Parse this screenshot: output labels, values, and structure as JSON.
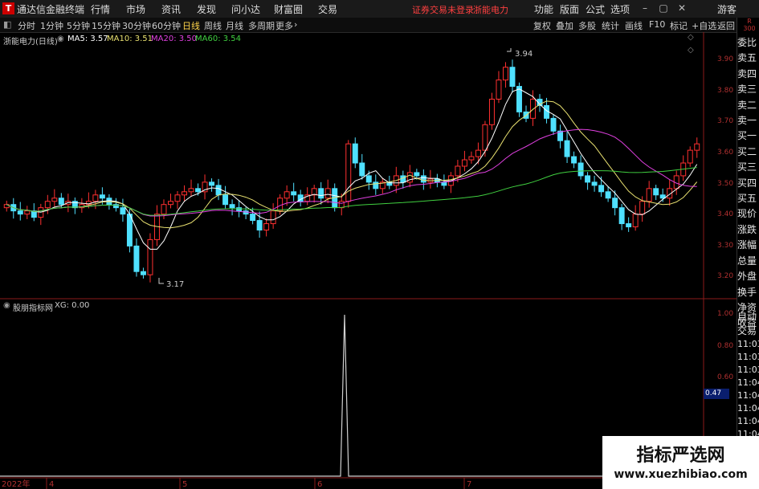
{
  "app": {
    "title": "通达信金融终端",
    "logo": "T"
  },
  "menu": [
    "行情",
    "市场",
    "资讯",
    "发现",
    "问小达",
    "财富圈",
    "交易"
  ],
  "notice": "证券交易未登录",
  "stock_name_top": "浙能电力",
  "top_right": [
    "功能",
    "版面",
    "公式",
    "选项"
  ],
  "guest": "游客",
  "periods": [
    "分时",
    "1分钟",
    "5分钟",
    "15分钟",
    "30分钟",
    "60分钟",
    "日线",
    "周线",
    "月线",
    "多周期",
    "更多"
  ],
  "active_period": "日线",
  "tools": [
    "复权",
    "叠加",
    "多股",
    "统计",
    "画线",
    "F10",
    "标记",
    "+自选",
    "返回"
  ],
  "main_legend": {
    "name": "浙能电力(日线)",
    "ma5": "MA5: 3.57",
    "ma10": "MA10: 3.51",
    "ma20": "MA20: 3.50",
    "ma60": "MA60: 3.54"
  },
  "sub_legend": {
    "name": "股朋指标网",
    "xg": "XG: 0.00"
  },
  "price_axis": [
    "3.90",
    "3.80",
    "3.70",
    "3.60",
    "3.50",
    "3.40",
    "3.30",
    "3.20"
  ],
  "sub_axis": [
    "1.00",
    "0.80",
    "0.60",
    "0.47"
  ],
  "annotations": {
    "high": "3.94",
    "low": "3.17"
  },
  "x_axis": [
    "2022年",
    "4",
    "5",
    "6",
    "7"
  ],
  "right_panel_top": [
    "委比",
    "卖五",
    "卖四",
    "卖三",
    "卖二",
    "卖一",
    "买一",
    "买二",
    "买三",
    "买四",
    "买五",
    "现价",
    "涨跌",
    "涨幅",
    "总量",
    "外盘",
    "换手",
    "净资",
    "收益"
  ],
  "right_panel_bottom": [
    "自动",
    "交易",
    "11:03",
    "11:03",
    "11:03",
    "11:04",
    "11:04",
    "11:04",
    "11:04",
    "11:04",
    "11:04"
  ],
  "right_corner": {
    "top": "R",
    "value": "300"
  },
  "watermark": {
    "line1": "指标严选网",
    "line2": "www.xuezhibiao.com"
  },
  "colors": {
    "up": "#ff3030",
    "down": "#4fe0ff",
    "ma5": "#ffffff",
    "ma10": "#e8e070",
    "ma20": "#e040e0",
    "ma60": "#40d040",
    "axis": "#b03030"
  },
  "chart_data": {
    "type": "candlestick",
    "price_range": [
      3.14,
      3.97
    ],
    "ma_values": {
      "MA5": 3.57,
      "MA10": 3.51,
      "MA20": 3.5,
      "MA60": 3.54
    },
    "xg_signal": {
      "value": 1.0,
      "baseline": 0.0
    }
  }
}
